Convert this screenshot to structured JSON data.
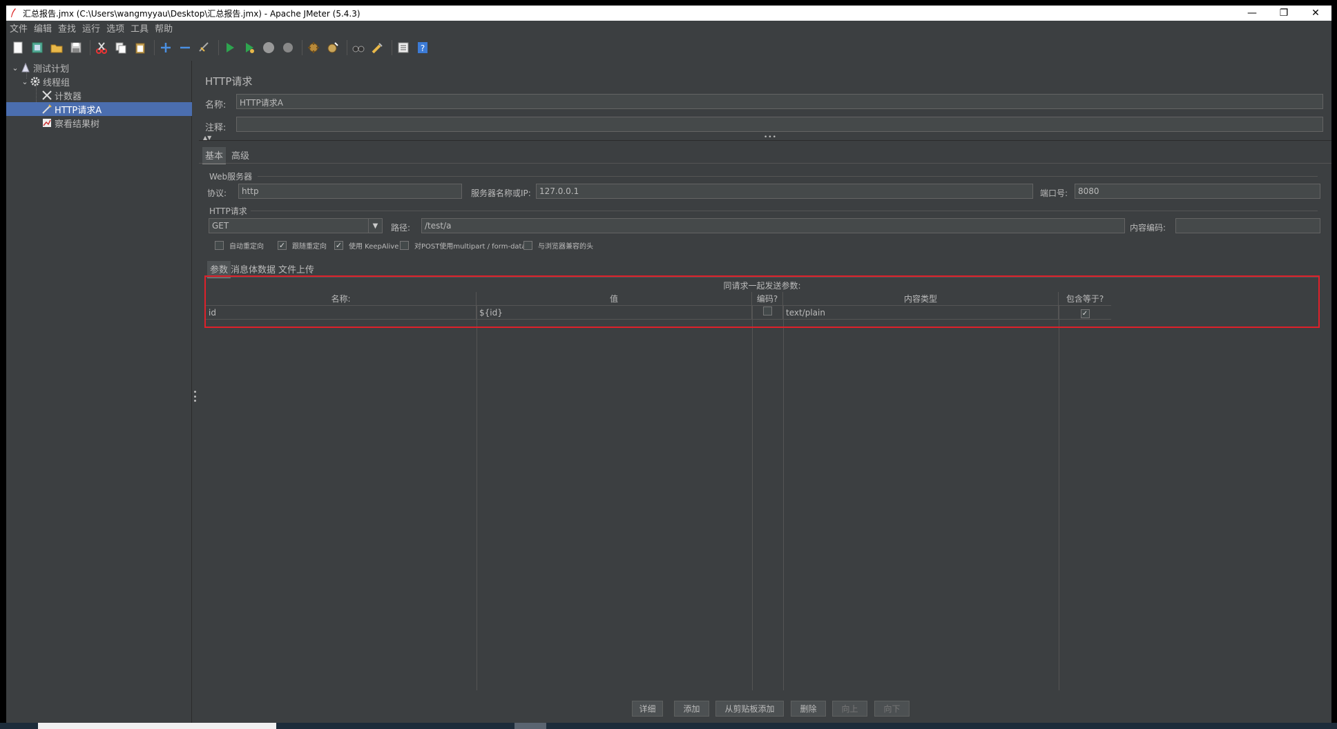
{
  "window": {
    "title": "汇总报告.jmx (C:\\Users\\wangmyyau\\Desktop\\汇总报告.jmx) - Apache JMeter (5.4.3)",
    "minimize": "—",
    "restore": "❐",
    "close": "✕"
  },
  "menu": [
    "文件",
    "编辑",
    "查找",
    "运行",
    "选项",
    "工具",
    "帮助"
  ],
  "toolbar_icons": [
    "new-icon",
    "templates-icon",
    "open-icon",
    "save-icon",
    "cut-icon",
    "copy-icon",
    "paste-icon",
    "expand-icon",
    "collapse-icon",
    "toggle-icon",
    "start-icon",
    "start-no-pause-icon",
    "stop-icon",
    "shutdown-icon",
    "clear-icon",
    "clear-all-icon",
    "search-icon",
    "reset-search-icon",
    "function-helper-icon",
    "help-icon"
  ],
  "tree": {
    "items": [
      {
        "label": "测试计划"
      },
      {
        "label": "线程组"
      },
      {
        "label": "计数器"
      },
      {
        "label": "HTTP请求A"
      },
      {
        "label": "察看结果树"
      }
    ]
  },
  "panel": {
    "title": "HTTP请求",
    "name_label": "名称:",
    "name_value": "HTTP请求A",
    "comment_label": "注释:",
    "comment_value": "",
    "tabs": [
      "基本",
      "高级"
    ],
    "web_server": {
      "group_title": "Web服务器",
      "protocol_label": "协议:",
      "protocol_value": "http",
      "server_label": "服务器名称或IP:",
      "server_value": "127.0.0.1",
      "port_label": "端口号:",
      "port_value": "8080"
    },
    "http_request": {
      "group_title": "HTTP请求",
      "method": "GET",
      "path_label": "路径:",
      "path_value": "/test/a",
      "encoding_label": "内容编码:",
      "encoding_value": ""
    },
    "options": [
      {
        "label": "自动重定向",
        "checked": false
      },
      {
        "label": "跟随重定向",
        "checked": true
      },
      {
        "label": "使用 KeepAlive",
        "checked": true
      },
      {
        "label": "对POST使用multipart / form-data",
        "checked": false
      },
      {
        "label": "与浏览器兼容的头",
        "checked": false
      }
    ],
    "sub_tabs": [
      "参数",
      "消息体数据",
      "文件上传"
    ],
    "params": {
      "caption": "同请求一起发送参数:",
      "headers": [
        "名称:",
        "值",
        "编码?",
        "内容类型",
        "包含等于?"
      ],
      "rows": [
        {
          "name": "id",
          "value": "${id}",
          "encode": false,
          "content_type": "text/plain",
          "include_equals": true
        }
      ]
    },
    "buttons": {
      "detail": "详细",
      "add": "添加",
      "add_clipboard": "从剪贴板添加",
      "delete": "删除",
      "up": "向上",
      "down": "向下"
    }
  },
  "colors": {
    "background": "#3c3f41",
    "selection": "#4b6eaf",
    "highlight_border": "#e0202a"
  }
}
